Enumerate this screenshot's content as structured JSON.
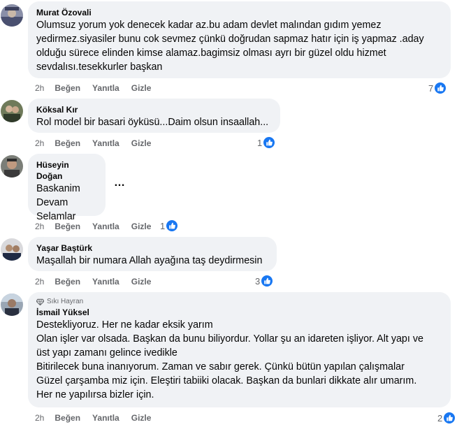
{
  "actions": {
    "like": "Beğen",
    "reply": "Yanıtla",
    "hide": "Gizle"
  },
  "comments": [
    {
      "author": "Murat Özovali",
      "time": "2h",
      "text": "Olumsuz yorum yok denecek kadar az.bu adam devlet malından gıdım yemez\nyedirmez.siyasiler bunu cok sevmez çünkü doğrudan sapmaz hatır için iş yapmaz .aday\nolduğu sürece elinden kimse alamaz.bagimsiz olması ayrı bir güzel oldu hizmet\nsevdalısı.tesekkurler başkan",
      "reactions": "7"
    },
    {
      "author": "Köksal Kır",
      "time": "2h",
      "text": "Rol model bir basari öyküsü...Daim olsun insaallah...",
      "reactions": "1"
    },
    {
      "author": "Hüseyin Doğan",
      "time": "2h",
      "text": "Baskanim\nDevam\nSelamlar",
      "reactions": "1",
      "more": "…"
    },
    {
      "author": "Yaşar Baştürk",
      "time": "2h",
      "text": "Maşallah bir numara Allah ayağına taş deydirmesin",
      "reactions": "3"
    },
    {
      "badge": "Sıkı Hayran",
      "author": "İsmail Yüksel",
      "time": "2h",
      "text": "Destekliyoruz. Her ne kadar eksik yarım\nOlan işler var olsada. Başkan da bunu biliyordur. Yollar şu an idareten işliyor. Alt yapı ve\nüst yapı zamanı gelince ivedikle\nBitirilecek buna inanıyorum. Zaman ve sabır gerek. Çünkü bütün yapılan çalışmalar\nGüzel çarşamba miz için. Eleştiri tabiiki olacak. Başkan da bunlari dikkate alır umarım.\nHer ne yapılırsa bizler için.",
      "reactions": "2"
    }
  ],
  "colors": {
    "like_blue": "#1877f2",
    "bubble": "#f0f2f5",
    "meta": "#65676b"
  }
}
